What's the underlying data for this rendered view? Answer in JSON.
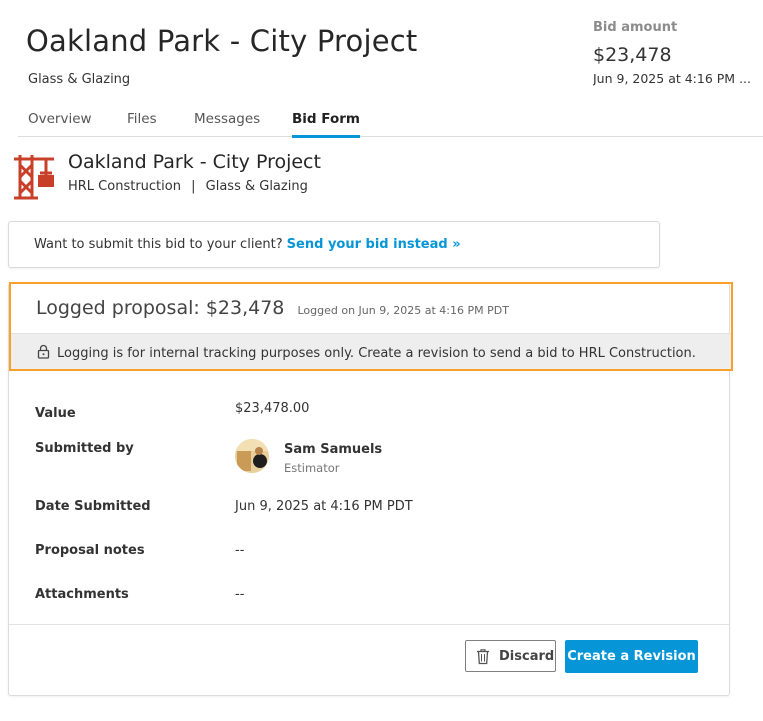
{
  "header": {
    "title": "Oakland Park - City Project",
    "subtitle": "Glass & Glazing",
    "bid_amount_label": "Bid amount",
    "bid_amount_value": "$23,478",
    "bid_amount_date": "Jun 9, 2025 at 4:16 PM ..."
  },
  "tabs": [
    {
      "label": "Overview",
      "active": false
    },
    {
      "label": "Files",
      "active": false
    },
    {
      "label": "Messages",
      "active": false
    },
    {
      "label": "Bid Form",
      "active": true
    }
  ],
  "project": {
    "name": "Oakland Park - City Project",
    "company": "HRL Construction",
    "separator": "|",
    "trade": "Glass & Glazing",
    "logo_icon": "crane-logo-icon",
    "logo_color": "#c8402a"
  },
  "notice": {
    "text": "Want to submit this bid to your client?",
    "link": "Send your bid instead »"
  },
  "proposal": {
    "title": "Logged proposal: $23,478",
    "logged_on": "Logged on Jun 9, 2025 at 4:16 PM PDT",
    "lock_message": "Logging is for internal tracking purposes only. Create a revision to send a bid to HRL Construction.",
    "highlight_color": "#f7a02a",
    "fields": {
      "value_label": "Value",
      "value": "$23,478.00",
      "submitted_by_label": "Submitted by",
      "submitter_name": "Sam Samuels",
      "submitter_role": "Estimator",
      "date_label": "Date Submitted",
      "date": "Jun 9, 2025 at 4:16 PM PDT",
      "notes_label": "Proposal notes",
      "notes": "--",
      "attachments_label": "Attachments",
      "attachments": "--"
    }
  },
  "actions": {
    "discard_label": "Discard",
    "create_label": "Create a Revision",
    "accent_color": "#0696d7"
  }
}
